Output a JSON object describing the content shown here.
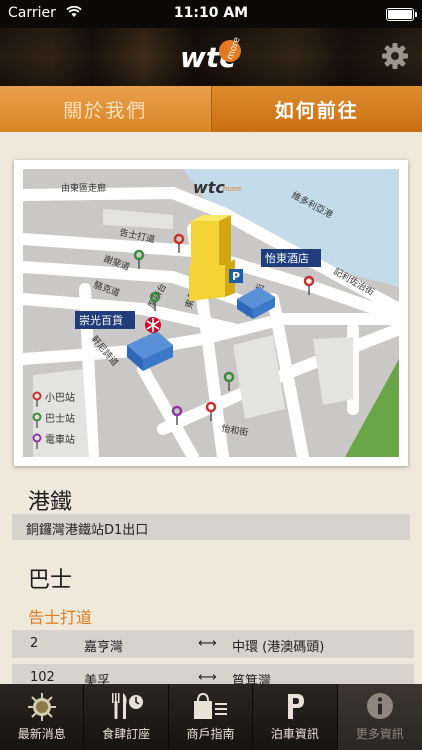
{
  "status": {
    "carrier": "Carrier",
    "time": "11:10 AM"
  },
  "header": {
    "logo_text": "wtc",
    "logo_sub": "more"
  },
  "tabs": [
    {
      "label": "關於我們",
      "active": false
    },
    {
      "label": "如何前往",
      "active": true
    }
  ],
  "map": {
    "roads": [
      "由東區走廊",
      "維多利亞港",
      "告士打道",
      "謝斐道",
      "駱克道",
      "軒尼詩道",
      "百德新街",
      "東角道",
      "怡和街",
      "摩頓台",
      "記利佐治街"
    ],
    "buildings": [
      "崇光百貨",
      "怡東酒店"
    ],
    "parking": "P",
    "logo_text": "wtc",
    "logo_sub": "more",
    "legend": [
      {
        "label": "小巴站",
        "color": "#c8302e"
      },
      {
        "label": "巴士站",
        "color": "#3a8a3a"
      },
      {
        "label": "電車站",
        "color": "#8a3a9c"
      }
    ]
  },
  "mtr": {
    "title": "港鐵",
    "exit": "銅鑼灣港鐵站D1出口"
  },
  "bus": {
    "title": "巴士",
    "road": "告士打道",
    "arrow": "⟷",
    "routes": [
      {
        "route": "2",
        "from": "嘉亨灣",
        "to": "中環 (港澳碼頭)"
      },
      {
        "route": "102",
        "from": "美孚",
        "to": "筲箕灣"
      }
    ]
  },
  "nav": [
    {
      "label": "最新消息",
      "icon": "news-icon"
    },
    {
      "label": "食肆訂座",
      "icon": "dining-icon"
    },
    {
      "label": "商戶指南",
      "icon": "shopping-icon"
    },
    {
      "label": "泊車資訊",
      "icon": "parking-icon"
    },
    {
      "label": "更多資訊",
      "icon": "info-icon",
      "active": true
    }
  ]
}
